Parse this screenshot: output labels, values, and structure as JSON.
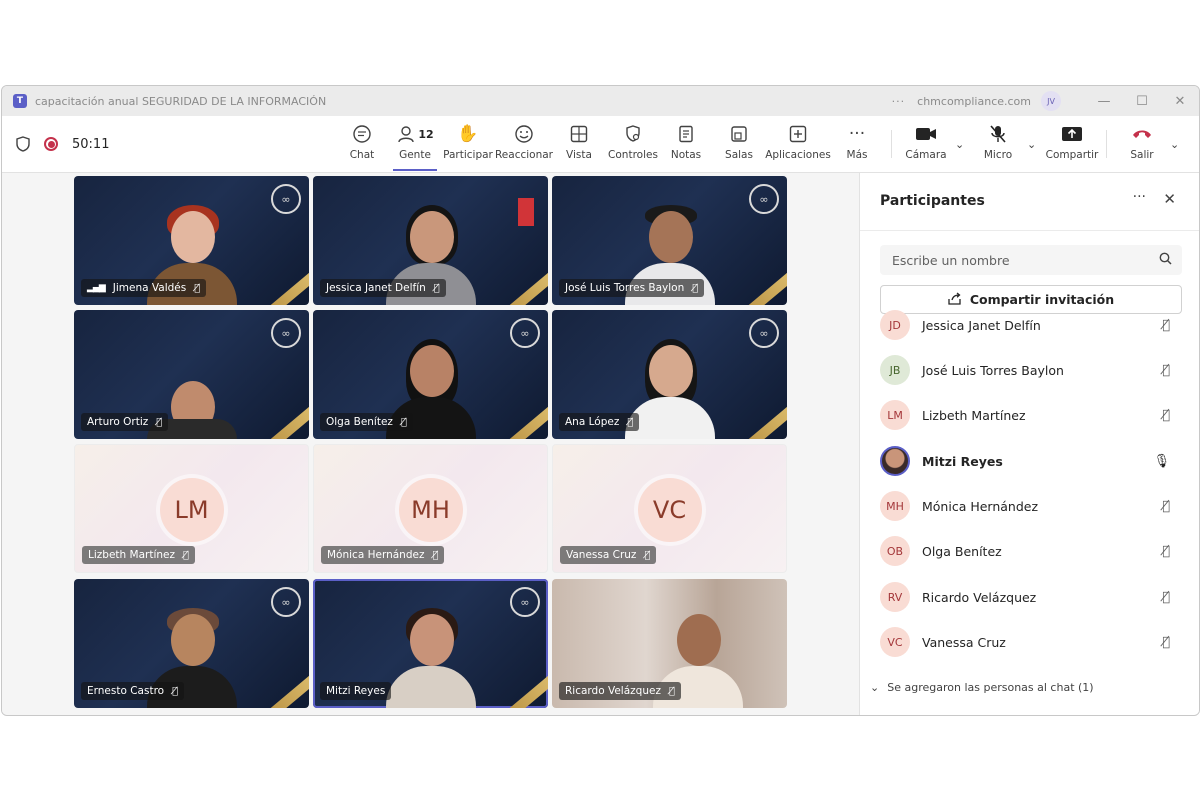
{
  "window": {
    "title": "capacitación anual SEGURIDAD DE LA INFORMACIÓN",
    "org": "chmcompliance.com",
    "user_initials": "JV",
    "dots": "···"
  },
  "toolbar": {
    "timer": "50:11",
    "items": [
      {
        "label": "Chat",
        "icon": "chat-icon"
      },
      {
        "label": "Gente",
        "icon": "people-icon",
        "badge": "12"
      },
      {
        "label": "Participar",
        "icon": "raise-hand-icon"
      },
      {
        "label": "Reaccionar",
        "icon": "smiley-icon"
      },
      {
        "label": "Vista",
        "icon": "grid-view-icon"
      },
      {
        "label": "Controles",
        "icon": "shield-gear-icon"
      },
      {
        "label": "Notas",
        "icon": "notes-icon"
      },
      {
        "label": "Salas",
        "icon": "rooms-icon"
      },
      {
        "label": "Aplicaciones",
        "icon": "add-apps-icon"
      },
      {
        "label": "Más",
        "icon": "more-icon"
      }
    ],
    "camera_label": "Cámara",
    "mic_label": "Micro",
    "share_label": "Compartir",
    "leave_label": "Salir",
    "leave_color": "#c4314b",
    "accent_color": "#5b5fc7"
  },
  "grid": [
    {
      "name": "Jimena Valdés",
      "type": "video"
    },
    {
      "name": "Jessica Janet Delfín",
      "type": "video"
    },
    {
      "name": "José Luis Torres Baylon",
      "type": "video"
    },
    {
      "name": "Arturo Ortiz",
      "type": "video"
    },
    {
      "name": "Olga Benítez",
      "type": "video"
    },
    {
      "name": "Ana López",
      "type": "video"
    },
    {
      "name": "Lizbeth Martínez",
      "type": "avatar",
      "initials": "LM"
    },
    {
      "name": "Mónica Hernández",
      "type": "avatar",
      "initials": "MH"
    },
    {
      "name": "Vanessa Cruz",
      "type": "avatar",
      "initials": "VC"
    },
    {
      "name": "Ernesto Castro",
      "type": "video"
    },
    {
      "name": "Mitzi Reyes",
      "type": "video",
      "selected": true
    },
    {
      "name": "Ricardo Velázquez",
      "type": "video"
    }
  ],
  "panel": {
    "title": "Participantes",
    "search_placeholder": "Escribe un nombre",
    "share_invite_label": "Compartir invitación",
    "participants": [
      {
        "initials": "JD",
        "name": "Jessica Janet Delfín",
        "mic": "muted"
      },
      {
        "initials": "JB",
        "name": "José Luis Torres Baylon",
        "mic": "muted"
      },
      {
        "initials": "LM",
        "name": "Lizbeth Martínez",
        "mic": "muted"
      },
      {
        "initials": "",
        "name": "Mitzi Reyes",
        "mic": "on"
      },
      {
        "initials": "MH",
        "name": "Mónica Hernández",
        "mic": "muted"
      },
      {
        "initials": "OB",
        "name": "Olga Benítez",
        "mic": "muted"
      },
      {
        "initials": "RV",
        "name": "Ricardo Velázquez",
        "mic": "muted"
      },
      {
        "initials": "VC",
        "name": "Vanessa Cruz",
        "mic": "muted"
      }
    ],
    "added_note": "Se agregaron las personas al chat (1)"
  }
}
